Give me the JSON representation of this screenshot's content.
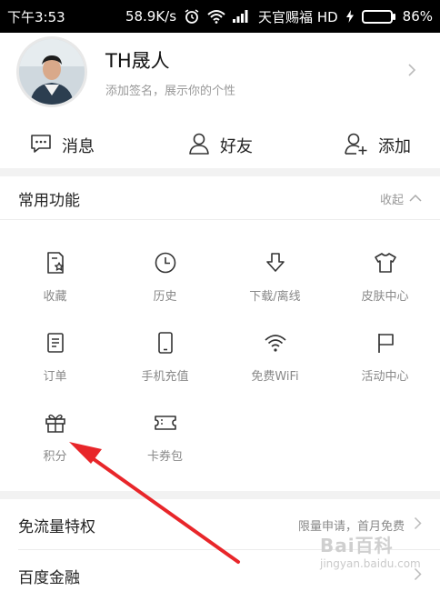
{
  "status_bar": {
    "time": "下午3:53",
    "speed": "58.9K/s",
    "carrier": "天官赐福 HD",
    "battery": "86%",
    "battery_level": 0.86
  },
  "profile": {
    "name": "TH晟人",
    "signature": "添加签名，展示你的个性"
  },
  "social": [
    {
      "label": "消息",
      "icon": "message-icon"
    },
    {
      "label": "好友",
      "icon": "friend-icon"
    },
    {
      "label": "添加",
      "icon": "add-friend-icon"
    }
  ],
  "common": {
    "title": "常用功能",
    "collapse_label": "收起"
  },
  "grid": [
    {
      "label": "收藏",
      "icon": "favorites-icon"
    },
    {
      "label": "历史",
      "icon": "history-icon"
    },
    {
      "label": "下载/离线",
      "icon": "download-icon"
    },
    {
      "label": "皮肤中心",
      "icon": "skin-icon"
    },
    {
      "label": "订单",
      "icon": "order-icon"
    },
    {
      "label": "手机充值",
      "icon": "phone-icon"
    },
    {
      "label": "免费WiFi",
      "icon": "wifi-icon"
    },
    {
      "label": "活动中心",
      "icon": "flag-icon"
    },
    {
      "label": "积分",
      "icon": "gift-icon"
    },
    {
      "label": "卡券包",
      "icon": "ticket-icon"
    }
  ],
  "rows": [
    {
      "title": "免流量特权",
      "meta": "限量申请，首月免费"
    },
    {
      "title": "百度金融",
      "meta": ""
    }
  ],
  "watermark": {
    "main": "Bai百科",
    "url": "jingyan.baidu.com"
  },
  "colors": {
    "annotation_arrow": "#e8262a",
    "battery": "#3fd12b"
  }
}
